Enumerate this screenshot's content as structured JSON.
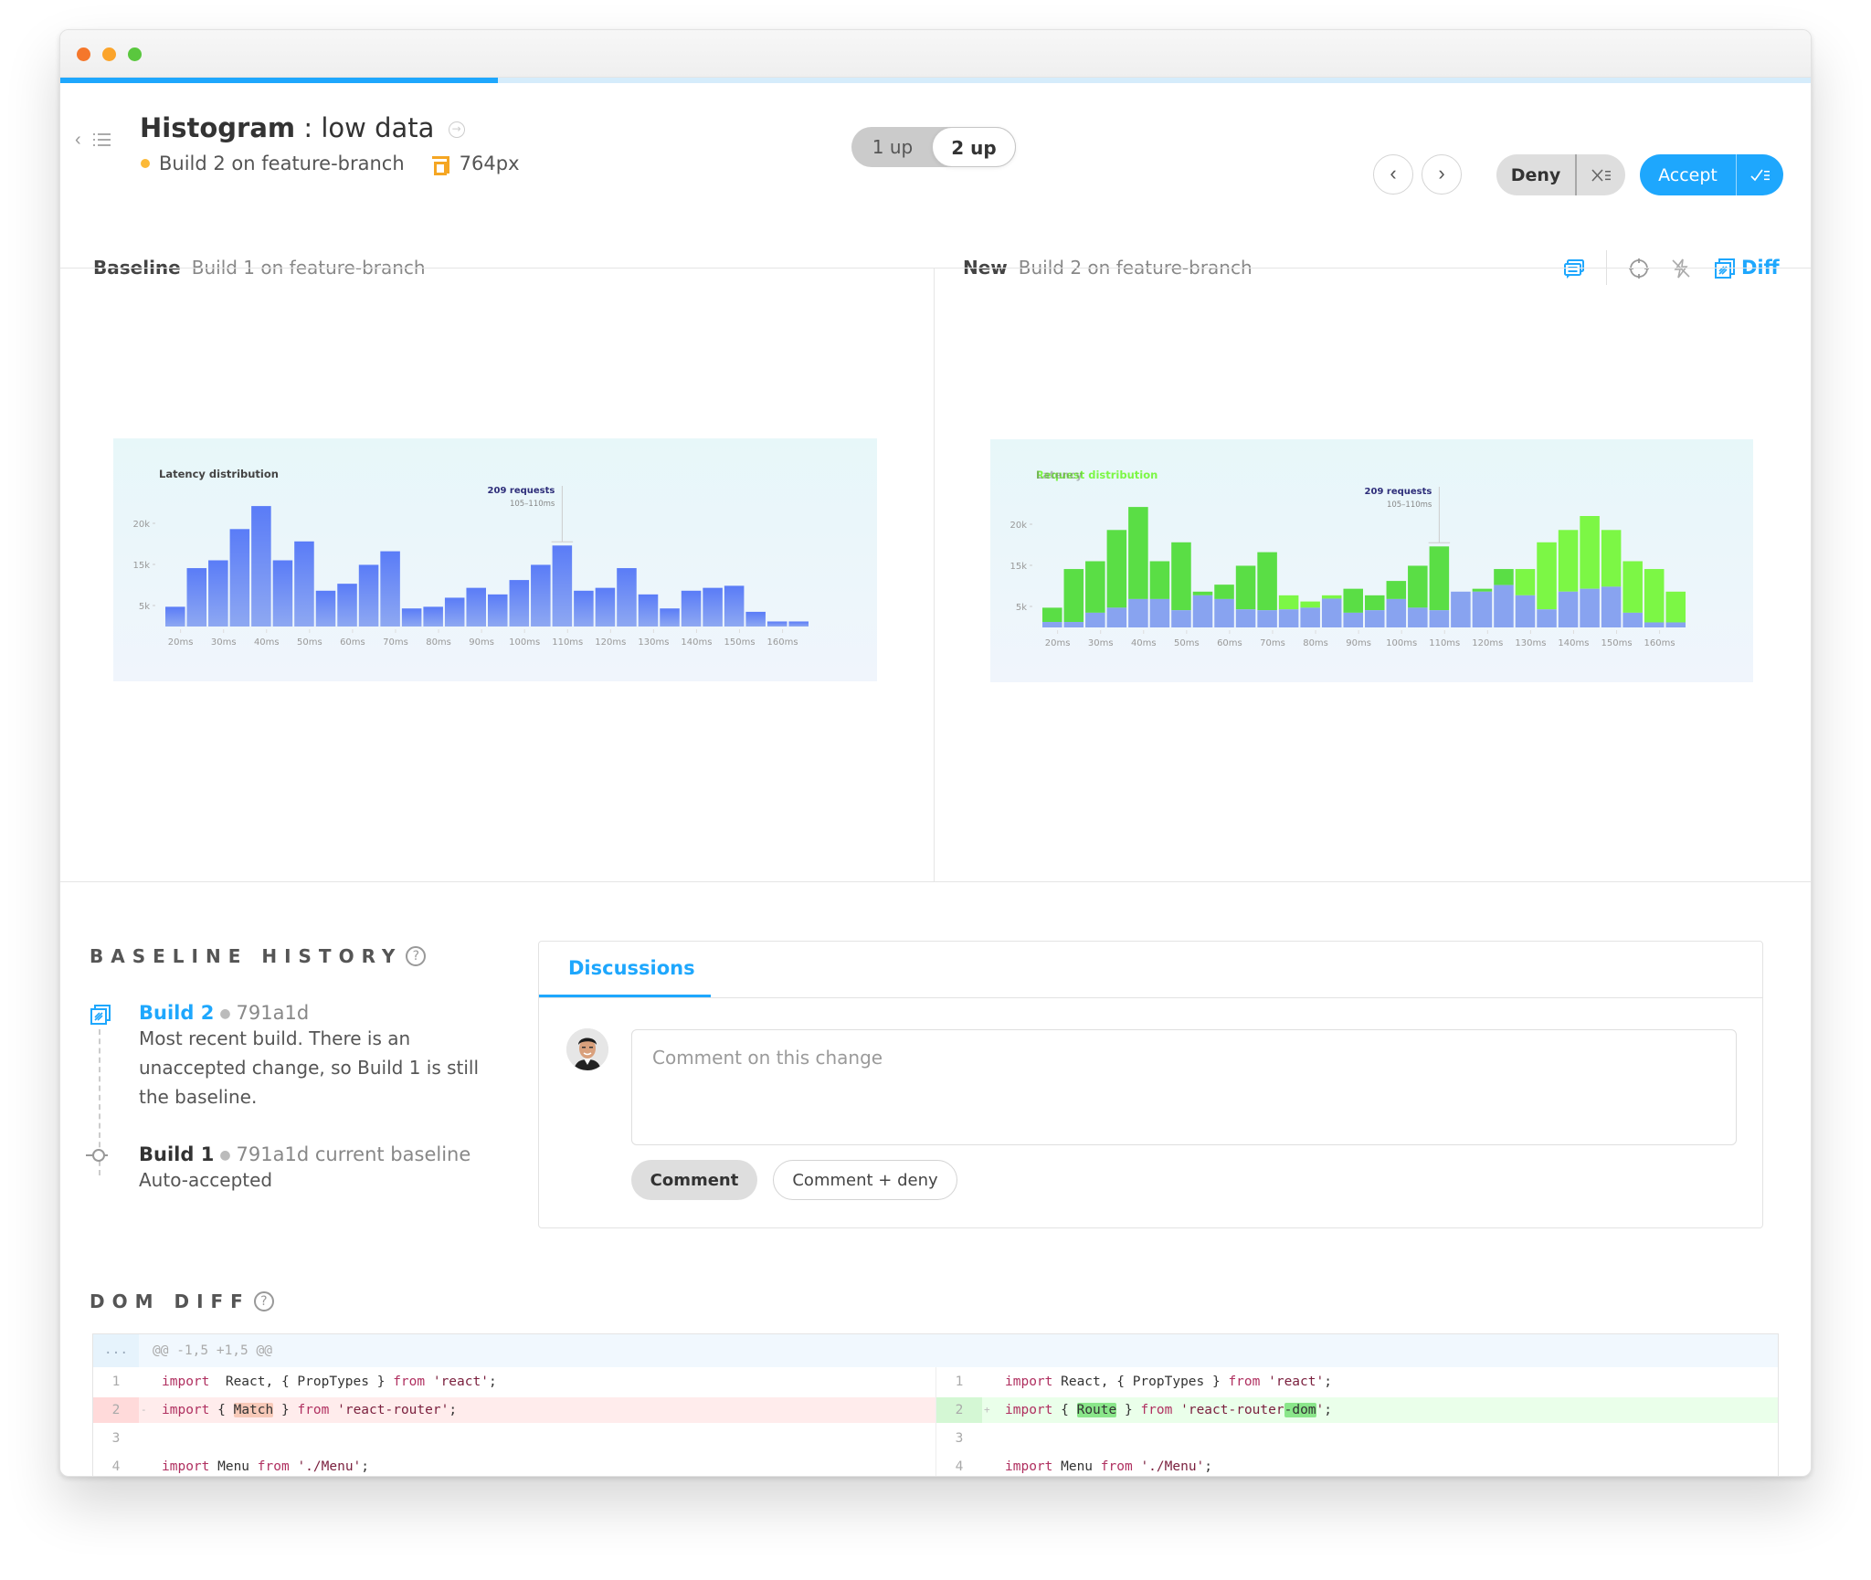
{
  "window": {
    "traffic_lights": [
      {
        "name": "close",
        "color": "#f5772b"
      },
      {
        "name": "minimize",
        "color": "#fba42b"
      },
      {
        "name": "zoom",
        "color": "#5ac73e"
      }
    ],
    "progress_fraction": 0.25
  },
  "header": {
    "back_icon": "chevron-left-icon",
    "list_icon": "list-icon",
    "component": "Histogram",
    "separator": ":",
    "story": "low data",
    "title_arrow_icon": "arrow-right-circle-icon",
    "build_status_color": "#fcb937",
    "build": "Build 2 on feature-branch",
    "viewport": "764px",
    "view_toggle": {
      "options": [
        "1 up",
        "2 up"
      ],
      "selected": "2 up"
    },
    "prev_label": "‹",
    "next_label": "›",
    "deny": {
      "label": "Deny",
      "batch_icon": "✕☰",
      "batch_text": "X≡"
    },
    "accept": {
      "label": "Accept",
      "batch_text": "✓≡"
    },
    "accent_color": "#1ea7fd"
  },
  "compare": {
    "baseline": {
      "label": "Baseline",
      "build": "Build 1 on feature-branch"
    },
    "new": {
      "label": "New",
      "build": "Build 2 on feature-branch"
    },
    "tools": {
      "comments_icon": "comments-icon",
      "focus_icon": "crosshair-icon",
      "strobe_icon": "flash-off-icon",
      "diff_icon": "diff-icon",
      "diff_label": "Diff"
    }
  },
  "chart_data": [
    {
      "type": "bar",
      "panel": "baseline",
      "title": "Latency distribution",
      "xlabel": "",
      "ylabel": "",
      "x_tick_labels": [
        "20ms",
        "30ms",
        "40ms",
        "50ms",
        "60ms",
        "70ms",
        "80ms",
        "90ms",
        "100ms",
        "110ms",
        "120ms",
        "130ms",
        "140ms",
        "150ms",
        "160ms"
      ],
      "y_tick_labels": [
        "20k",
        "15k",
        "5k"
      ],
      "bin_start_ms": 15,
      "bin_width_ms": 5,
      "values_k": [
        4.7,
        14.1,
        15.5,
        19.3,
        22.1,
        15.5,
        17.8,
        8.6,
        10.3,
        14.9,
        16.6,
        4.3,
        4.7,
        6.9,
        9.3,
        7.7,
        11.2,
        14.9,
        17.3,
        8.6,
        9.3,
        14.1,
        7.7,
        4.3,
        8.6,
        9.3,
        9.8,
        3.5,
        1.2,
        1.2
      ],
      "annotation": {
        "title": "209 requests",
        "subtitle": "105–110ms",
        "bin_index": 18
      },
      "bar_color": "#6a8cf5",
      "grid": false
    },
    {
      "type": "bar",
      "panel": "new-diff",
      "title": "Request distribution",
      "title_overlay": "Latency",
      "xlabel": "",
      "ylabel": "",
      "x_tick_labels": [
        "20ms",
        "30ms",
        "40ms",
        "50ms",
        "60ms",
        "70ms",
        "80ms",
        "90ms",
        "100ms",
        "110ms",
        "120ms",
        "130ms",
        "140ms",
        "150ms",
        "160ms"
      ],
      "y_tick_labels": [
        "20k",
        "15k",
        "5k"
      ],
      "bin_start_ms": 15,
      "bin_width_ms": 5,
      "series": [
        {
          "name": "baseline",
          "values_k": [
            4.7,
            14.1,
            15.5,
            19.3,
            22.1,
            15.5,
            17.8,
            8.6,
            10.3,
            14.9,
            16.6,
            4.3,
            4.7,
            6.9,
            9.3,
            7.7,
            11.2,
            14.9,
            17.3,
            8.6,
            9.3,
            14.1,
            7.7,
            4.3,
            8.6,
            9.3,
            9.8,
            3.5,
            1.2,
            1.2
          ]
        },
        {
          "name": "new",
          "values_k": [
            1.3,
            1.3,
            3.5,
            4.7,
            6.8,
            6.8,
            4.1,
            7.7,
            6.8,
            4.3,
            4.1,
            7.7,
            6.2,
            7.7,
            3.5,
            4.1,
            6.8,
            4.7,
            4.1,
            8.6,
            8.6,
            10.2,
            14.1,
            17.8,
            19.3,
            21.0,
            19.3,
            15.5,
            14.1,
            8.6
          ]
        }
      ],
      "diff_colors": {
        "unchanged": "#88a3f0",
        "removed": "#5ade45",
        "added": "#7cf745"
      },
      "annotation": {
        "title": "209 requests",
        "subtitle": "105–110ms",
        "bin_index": 18
      },
      "grid": false
    }
  ],
  "baseline_history": {
    "title": "BASELINE HISTORY",
    "help_icon": "?",
    "items": [
      {
        "build": "Build 2",
        "hash": "791a1d",
        "note": "",
        "description": "Most recent build. There is an unaccepted change, so Build 1 is still the baseline.",
        "icon": "diff-icon"
      },
      {
        "build": "Build 1",
        "hash": "791a1d",
        "note": "current baseline",
        "description": "Auto-accepted",
        "icon": "commit-node-icon"
      }
    ]
  },
  "discussions": {
    "tab": "Discussions",
    "placeholder": "Comment on this change",
    "value": "",
    "comment_button": "Comment",
    "comment_deny_button": "Comment + deny"
  },
  "dom_diff": {
    "title": "DOM DIFF",
    "help_icon": "?",
    "hunk_dots": "...",
    "hunk": "@@ -1,5 +1,5 @@",
    "left": [
      {
        "n": "1",
        "mark": "",
        "type": "context",
        "parts": [
          [
            "kw",
            "import"
          ],
          [
            "",
            "  React, { PropTypes } "
          ],
          [
            "kw",
            "from"
          ],
          [
            "",
            " "
          ],
          [
            "str",
            "'react'"
          ],
          [
            "",
            ";"
          ]
        ]
      },
      {
        "n": "2",
        "mark": "-",
        "type": "removed",
        "parts": [
          [
            "kw",
            "import"
          ],
          [
            "",
            " { "
          ],
          [
            "hl-rem",
            "Match"
          ],
          [
            "",
            " } "
          ],
          [
            "kw",
            "from"
          ],
          [
            "",
            " "
          ],
          [
            "str",
            "'react-router'"
          ],
          [
            "",
            ";"
          ]
        ]
      },
      {
        "n": "3",
        "mark": "",
        "type": "context",
        "parts": []
      },
      {
        "n": "4",
        "mark": "",
        "type": "context",
        "parts": [
          [
            "kw",
            "import"
          ],
          [
            "",
            " Menu "
          ],
          [
            "kw",
            "from"
          ],
          [
            "",
            " "
          ],
          [
            "str",
            "'./Menu'"
          ],
          [
            "",
            ";"
          ]
        ]
      }
    ],
    "right": [
      {
        "n": "1",
        "mark": "",
        "type": "context",
        "parts": [
          [
            "kw",
            "import"
          ],
          [
            "",
            " React, { PropTypes } "
          ],
          [
            "kw",
            "from"
          ],
          [
            "",
            " "
          ],
          [
            "str",
            "'react'"
          ],
          [
            "",
            ";"
          ]
        ]
      },
      {
        "n": "2",
        "mark": "+",
        "type": "added",
        "parts": [
          [
            "kw",
            "import"
          ],
          [
            "",
            " { "
          ],
          [
            "hl-add",
            "Route"
          ],
          [
            "",
            " } "
          ],
          [
            "kw",
            "from"
          ],
          [
            "",
            " "
          ],
          [
            "str",
            "'react-router"
          ],
          [
            "hl-add",
            "-dom"
          ],
          [
            "str",
            "'"
          ],
          [
            "",
            ";"
          ]
        ]
      },
      {
        "n": "3",
        "mark": "",
        "type": "context",
        "parts": []
      },
      {
        "n": "4",
        "mark": "",
        "type": "context",
        "parts": [
          [
            "kw",
            "import"
          ],
          [
            "",
            " Menu "
          ],
          [
            "kw",
            "from"
          ],
          [
            "",
            " "
          ],
          [
            "str",
            "'./Menu'"
          ],
          [
            "",
            ";"
          ]
        ]
      }
    ]
  }
}
